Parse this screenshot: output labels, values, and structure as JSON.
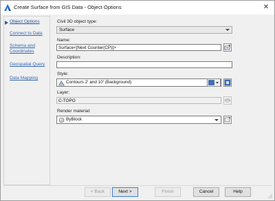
{
  "window": {
    "title": "Create Surface from GIS Data - Object Options",
    "close_glyph": "✕"
  },
  "nav": {
    "items": [
      {
        "label": "Object Options",
        "active": true
      },
      {
        "label": "Connect to Data"
      },
      {
        "label": "Schema and Coordinates"
      },
      {
        "label": "Geospatial Query"
      },
      {
        "label": "Data Mapping"
      }
    ]
  },
  "form": {
    "object_type_label": "Civil 3D object type:",
    "object_type_value": "Surface",
    "name_label": "Name:",
    "name_value": "Surface<[Next Counter(CP)]>",
    "description_label": "Description:",
    "description_value": "",
    "style_label": "Style:",
    "style_value": "Contours 2' and 10' (Background)",
    "layer_label": "Layer:",
    "layer_value": "C-TOPO",
    "render_label": "Render material:",
    "render_value": "ByBlock"
  },
  "footer": {
    "back": "< Back",
    "next": "Next >",
    "finish": "Finish",
    "cancel": "Cancel",
    "help": "Help"
  },
  "colors": {
    "accent": "#2e59b6",
    "link": "#3568b0"
  }
}
